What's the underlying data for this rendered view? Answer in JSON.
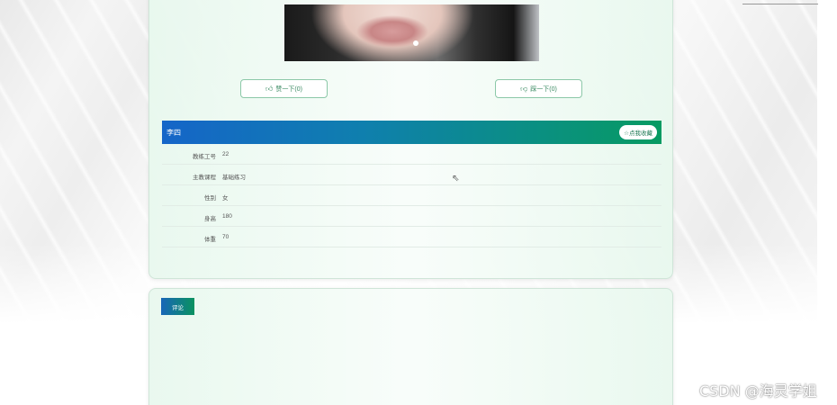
{
  "buttons": {
    "like_label": "赞一下(0)",
    "dislike_label": "踩一下(0)"
  },
  "coach": {
    "name": "李四",
    "favorite_label": "☆点我收藏",
    "fields": [
      {
        "label": "教练工号",
        "value": "22"
      },
      {
        "label": "主教课程",
        "value": "基础练习"
      },
      {
        "label": "性别",
        "value": "女"
      },
      {
        "label": "身高",
        "value": "180"
      },
      {
        "label": "体重",
        "value": "70"
      }
    ]
  },
  "comment": {
    "tab_label": "评论"
  },
  "watermark": "CSDN @海灵学姐",
  "colors": {
    "header_start": "#1565c8",
    "header_end": "#079b62",
    "button_border": "#8cc8a8"
  },
  "icons": {
    "like": "thumbs-up-icon",
    "dislike": "thumbs-down-icon"
  }
}
